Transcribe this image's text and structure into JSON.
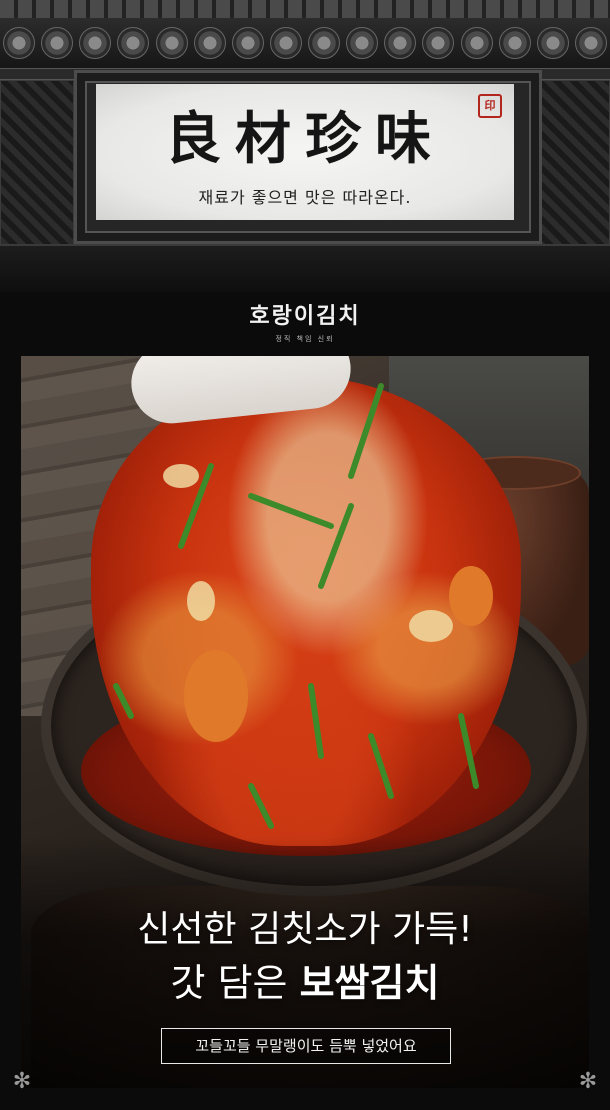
{
  "signboard": {
    "hanja": "良材珍味",
    "seal": "印",
    "tagline": "재료가 좋으면 맛은 따라온다."
  },
  "brand": {
    "name": "호랑이김치",
    "subtitle": "정직 책임 신뢰"
  },
  "promo": {
    "line1": "신선한 김칫소가 가득!",
    "line2_prefix": "갓 담은 ",
    "line2_bold": "보쌈김치",
    "badge": "꼬들꼬들 무말랭이도 듬뿍 넣었어요"
  },
  "icons": {
    "corner_left": "snowflake-ornament-icon",
    "corner_right": "snowflake-ornament-icon"
  },
  "colors": {
    "background": "#0b0b0b",
    "kimchi_red": "#c8330f",
    "seal_red": "#b3261e"
  }
}
